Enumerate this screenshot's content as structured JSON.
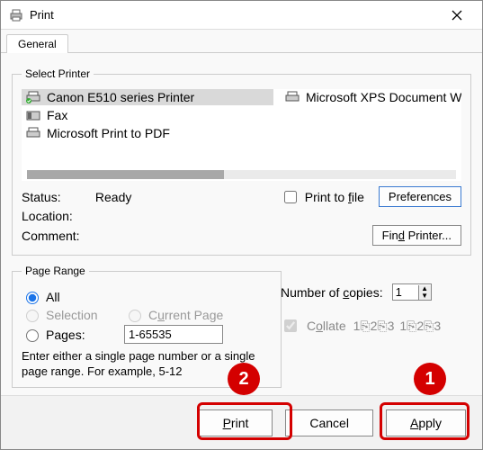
{
  "window": {
    "title": "Print"
  },
  "tabs": {
    "general": "General"
  },
  "selectPrinter": {
    "legend": "Select Printer",
    "items": [
      {
        "name": "Canon E510 series Printer",
        "selected": true
      },
      {
        "name": "Fax",
        "selected": false
      },
      {
        "name": "Microsoft Print to PDF",
        "selected": false
      },
      {
        "name": "Microsoft XPS Document W",
        "selected": false
      }
    ]
  },
  "status": {
    "status_label": "Status:",
    "status_value": "Ready",
    "location_label": "Location:",
    "location_value": "",
    "comment_label": "Comment:",
    "comment_value": "",
    "print_to_file": "Print to file",
    "preferences": "Preferences",
    "find_printer": "Find Printer..."
  },
  "pageRange": {
    "legend": "Page Range",
    "all": "All",
    "selection": "Selection",
    "current_page": "Current Page",
    "pages": "Pages:",
    "pages_value": "1-65535",
    "hint": "Enter either a single page number or a single page range.  For example, 5-12"
  },
  "copies": {
    "label": "Number of copies:",
    "value": "1",
    "collate": "Collate"
  },
  "footer": {
    "print": "Print",
    "cancel": "Cancel",
    "apply": "Apply"
  },
  "callouts": {
    "one": "1",
    "two": "2"
  },
  "accesskeys": {
    "file_u": "f",
    "find_u": "d",
    "print_u": "P",
    "apply_u": "A",
    "collate_u": "o",
    "copies_u": "c",
    "currentpage_u": "u"
  }
}
